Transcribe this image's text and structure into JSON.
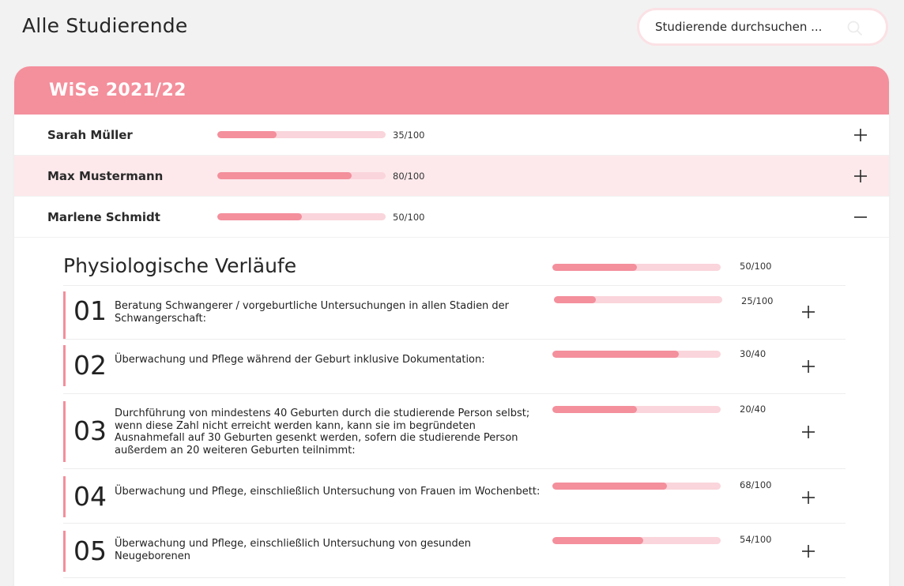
{
  "header": {
    "title": "Alle Studierende"
  },
  "search": {
    "placeholder": "Studierende durchsuchen ..."
  },
  "semester": {
    "label": "WiSe 2021/22"
  },
  "students": [
    {
      "name": "Sarah Müller",
      "score": "35/100",
      "progress": 0.35,
      "expanded": false
    },
    {
      "name": "Max Mustermann",
      "score": "80/100",
      "progress": 0.8,
      "expanded": false
    },
    {
      "name": "Marlene Schmidt",
      "score": "50/100",
      "progress": 0.5,
      "expanded": true
    }
  ],
  "detail": {
    "title": "Physiologische Verläufe",
    "score": "50/100",
    "progress": 0.5,
    "competencies": [
      {
        "number": "01",
        "text": "Beratung Schwangerer / vorgeburtliche Untersuchungen in allen Stadien der Schwangerschaft:",
        "score": "25/100",
        "progress": 0.25
      },
      {
        "number": "02",
        "text": "Überwachung und Pflege während der Geburt inklusive Dokumentation:",
        "score": "30/40",
        "progress": 0.75
      },
      {
        "number": "03",
        "text": "Durchführung von mindestens 40 Geburten durch die studierende Person selbst; wenn diese Zahl nicht erreicht werden kann, kann sie im begründeten Ausnahmefall auf 30 Geburten gesenkt werden, sofern die studierende Person außerdem an 20 weiteren Geburten teilnimmt:",
        "score": "20/40",
        "progress": 0.5
      },
      {
        "number": "04",
        "text": "Überwachung und Pflege, einschließlich Untersuchung von Frauen im Wochenbett:",
        "score": "68/100",
        "progress": 0.68
      },
      {
        "number": "05",
        "text": "Überwachung und Pflege, einschließlich Untersuchung von gesunden Neugeborenen",
        "score": "54/100",
        "progress": 0.54
      }
    ]
  },
  "icons": {
    "search": "search-icon",
    "expand": "plus-icon",
    "collapse": "minus-icon"
  },
  "colors": {
    "accent": "#f48f9c",
    "accent_light": "#fad5db",
    "row_highlight": "#fde9ec"
  }
}
